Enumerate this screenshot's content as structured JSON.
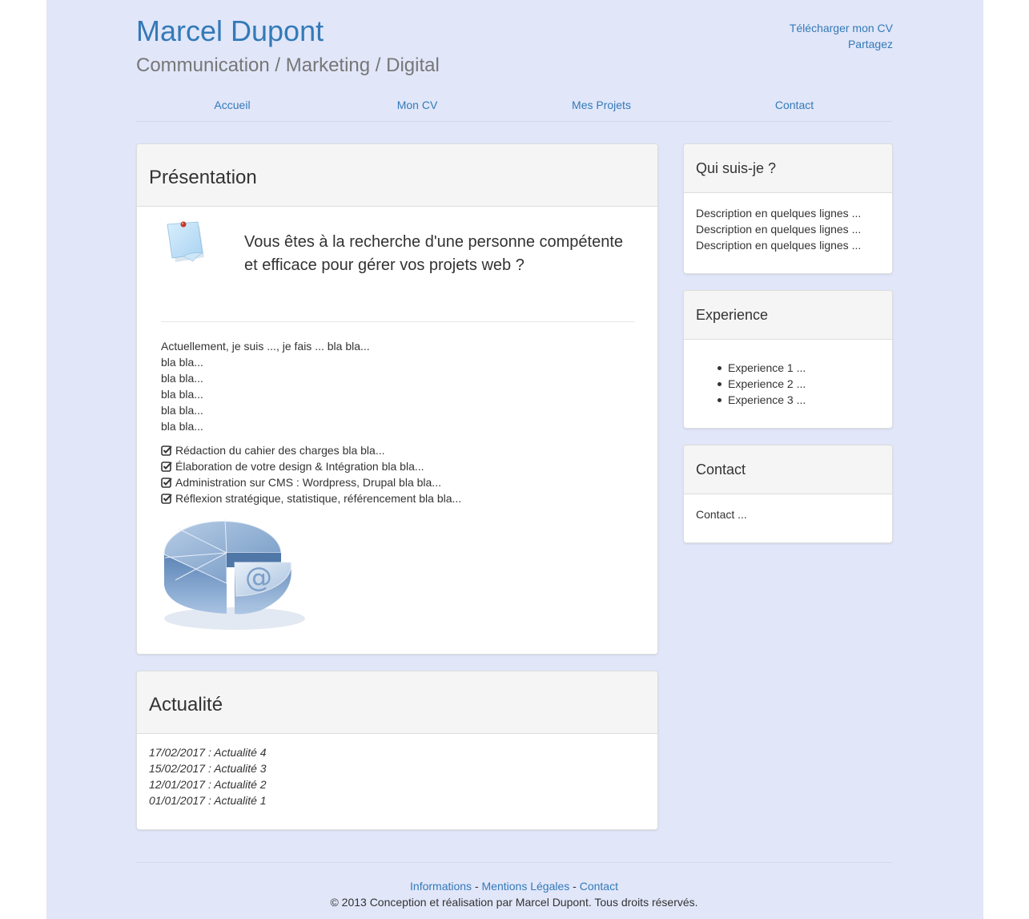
{
  "header": {
    "name": "Marcel Dupont",
    "tagline": "Communication / Marketing / Digital",
    "links": [
      "Télécharger mon CV",
      "Partagez"
    ]
  },
  "nav": {
    "items": [
      "Accueil",
      "Mon CV",
      "Mes Projets",
      "Contact"
    ]
  },
  "presentation": {
    "title": "Présentation",
    "lead": "Vous êtes à la recherche d'une personne compétente et efficace pour gérer vos projets web ?",
    "paragraph_lines": [
      "Actuellement, je suis ..., je fais ... bla bla...",
      "bla bla...",
      "bla bla...",
      "bla bla...",
      "bla bla...",
      "bla bla..."
    ],
    "checklist": [
      "Rédaction du cahier des charges bla bla...",
      "Élaboration de votre design & Intégration bla bla...",
      "Administration sur CMS : Wordpress, Drupal bla bla...",
      "Réflexion stratégique, statistique, référencement bla bla..."
    ],
    "image_icons": [
      "sticky-note-icon",
      "pie-chart-at-sign-icon"
    ]
  },
  "news": {
    "title": "Actualité",
    "items": [
      "17/02/2017 : Actualité 4",
      "15/02/2017 : Actualité 3",
      "12/01/2017 : Actualité 2",
      "01/01/2017 : Actualité 1"
    ]
  },
  "sidebar": {
    "about": {
      "title": "Qui suis-je ?",
      "lines": [
        "Description en quelques lignes ...",
        "Description en quelques lignes ...",
        "Description en quelques lignes ..."
      ]
    },
    "experience": {
      "title": "Experience",
      "items": [
        "Experience 1 ...",
        "Experience 2 ...",
        "Experience 3 ..."
      ]
    },
    "contact": {
      "title": "Contact",
      "text": "Contact ..."
    }
  },
  "footer": {
    "links": [
      "Informations",
      "Mentions Légales",
      "Contact"
    ],
    "separator": "-",
    "copyright": "© 2013 Conception et réalisation par Marcel Dupont. Tous droits réservés."
  },
  "colors": {
    "page_background": "#e1e6f9",
    "link": "#337ab7",
    "subtitle": "#777777",
    "panel_heading": "#f5f5f5"
  }
}
